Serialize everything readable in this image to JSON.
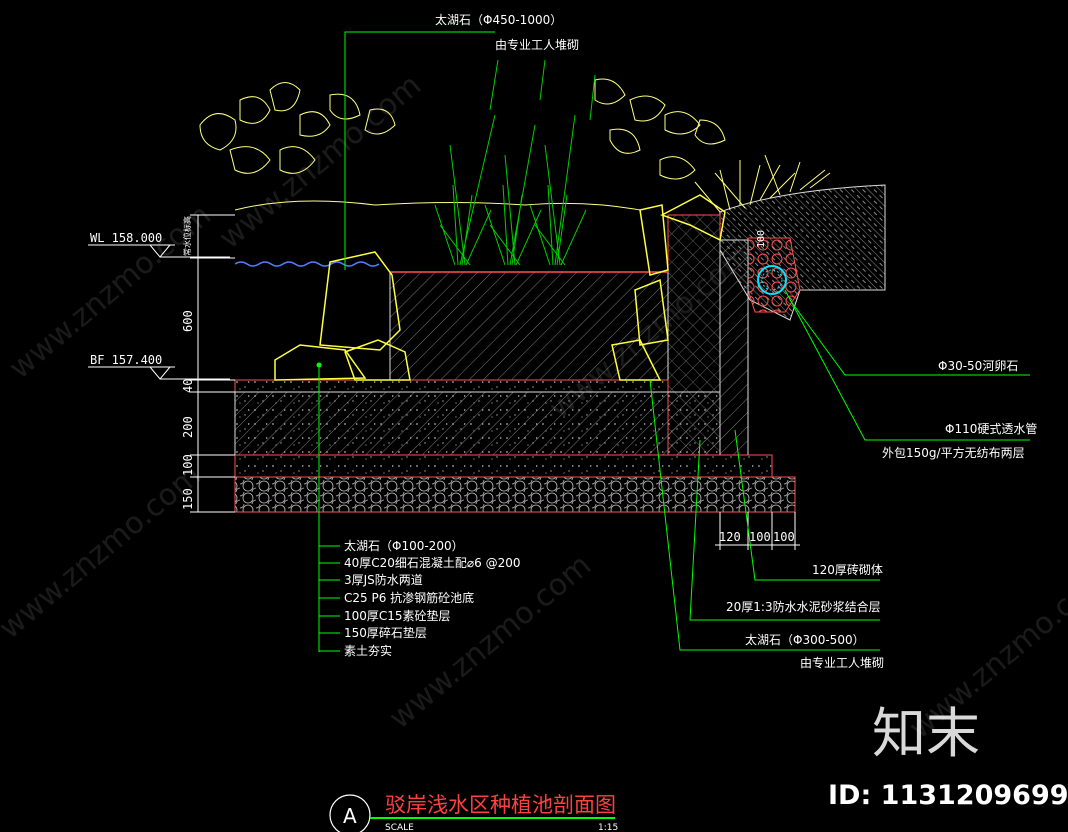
{
  "drawing": {
    "title": "驳岸浅水区种植池剖面图",
    "section_mark": "A",
    "scale_label": "SCALE",
    "scale_value": "1:15"
  },
  "levels": {
    "wl": "WL 158.000",
    "bf": "BF 157.400",
    "vertical_tag": "常水位标高"
  },
  "dims_left": [
    "600",
    "40",
    "200",
    "100",
    "150"
  ],
  "dims_bottom": [
    "120",
    "100",
    "100"
  ],
  "dim_right_small": "100",
  "callouts": {
    "top_stone_1": "太湖石（Φ450-1000）",
    "top_stone_2": "由专业工人堆砌",
    "pebble": "Φ30-50河卵石",
    "pipe_1": "Φ110硬式透水管",
    "pipe_2": "外包150g/平方无纺布两层",
    "brick": "120厚砖砌体",
    "mortar": "20厚1:3防水水泥砂浆结合层",
    "bottom_stone_1": "太湖石（Φ300-500）",
    "bottom_stone_2": "由专业工人堆砌"
  },
  "layers": [
    "太湖石（Φ100-200）",
    "40厚C20细石混凝土配⌀6 @200",
    "3厚JS防水两道",
    "C25 P6 抗渗钢筋砼池底",
    "100厚C15素砼垫层",
    "150厚碎石垫层",
    "素土夯实"
  ],
  "watermark": {
    "logo": "知末",
    "id": "ID: 1131209699",
    "site": "www.znzmo.com"
  },
  "colors": {
    "background": "#000000",
    "leader": "#00ff00",
    "outline_red": "#ff5050",
    "stone": "#ffff40",
    "water": "#4f7fff",
    "plant_green": "#00d000",
    "shrub": "#ffff80",
    "text": "#ffffff"
  }
}
